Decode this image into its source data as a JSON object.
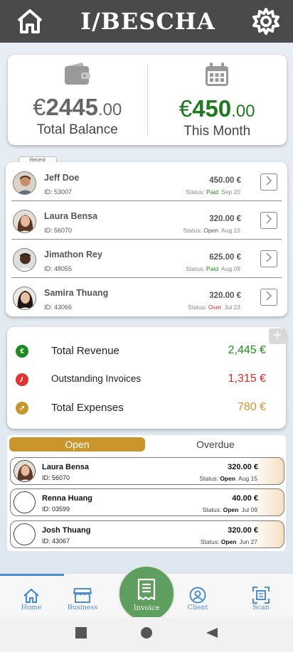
{
  "header": {
    "title": "I/BESCHA",
    "home_icon": "home-icon",
    "settings_icon": "gear-icon",
    "background": "#4a4a4a"
  },
  "balance": {
    "total": {
      "currency": "€",
      "whole": "2445",
      "cents": ".00",
      "label": "Total Balance",
      "icon": "wallet-icon"
    },
    "month": {
      "currency": "€",
      "whole": "450",
      "cents": ".00",
      "label": "This Month",
      "icon": "calendar-icon"
    }
  },
  "recent": {
    "tab_label": "Recent",
    "items": [
      {
        "name": "Jeff Doe",
        "id": "ID: 53007",
        "amount": "450.00 €",
        "status_label": "Status:",
        "status": "Paid",
        "date": "Sep 20"
      },
      {
        "name": "Laura Bensa",
        "id": "ID: 56070",
        "amount": "320.00 €",
        "status_label": "Status:",
        "status": "Open",
        "date": "Aug 15"
      },
      {
        "name": "Jimathon Rey",
        "id": "ID: 48055",
        "amount": "625.00 €",
        "status_label": "Status:",
        "status": "Paid",
        "date": "Aug 09"
      },
      {
        "name": "Samira Thuang",
        "id": "ID: 43066",
        "amount": "320.00 €",
        "status_label": "Status:",
        "status": "Over",
        "date": "Jul 23"
      }
    ]
  },
  "summary": {
    "add_label": "+",
    "items": [
      {
        "label": "Total Revenue",
        "value": "2,445  €",
        "color": "#1f8a1f",
        "icon": "euro-icon",
        "icon_glyph": "€"
      },
      {
        "label": "Outstanding Invoices",
        "value": "1,315  €",
        "color": "#d92b2b",
        "icon": "clock-icon",
        "icon_glyph": ""
      },
      {
        "label": "Total Expenses",
        "value": "780  €",
        "color": "#c9952c",
        "icon": "arrow-up-right-icon",
        "icon_glyph": "↗"
      }
    ]
  },
  "invoices": {
    "tabs": {
      "open": "Open",
      "overdue": "Overdue"
    },
    "items": [
      {
        "name": "Laura Bensa",
        "id": "ID: 56070",
        "amount": "320.00 €",
        "status_label": "Status:",
        "status": "Open",
        "date": "Aug 15"
      },
      {
        "name": "Renna Huang",
        "id": "ID: 03599",
        "amount": "40.00 €",
        "status_label": "Status:",
        "status": "Open",
        "date": "Jul 09"
      },
      {
        "name": "Josh Thuang",
        "id": "ID: 43067",
        "amount": "320.00 €",
        "status_label": "Status:",
        "status": "Open",
        "date": "Jun 27"
      }
    ]
  },
  "nav": {
    "home": "Home",
    "business": "Business",
    "invoice": "Invoice",
    "client": "Client",
    "scan": "Scan"
  }
}
